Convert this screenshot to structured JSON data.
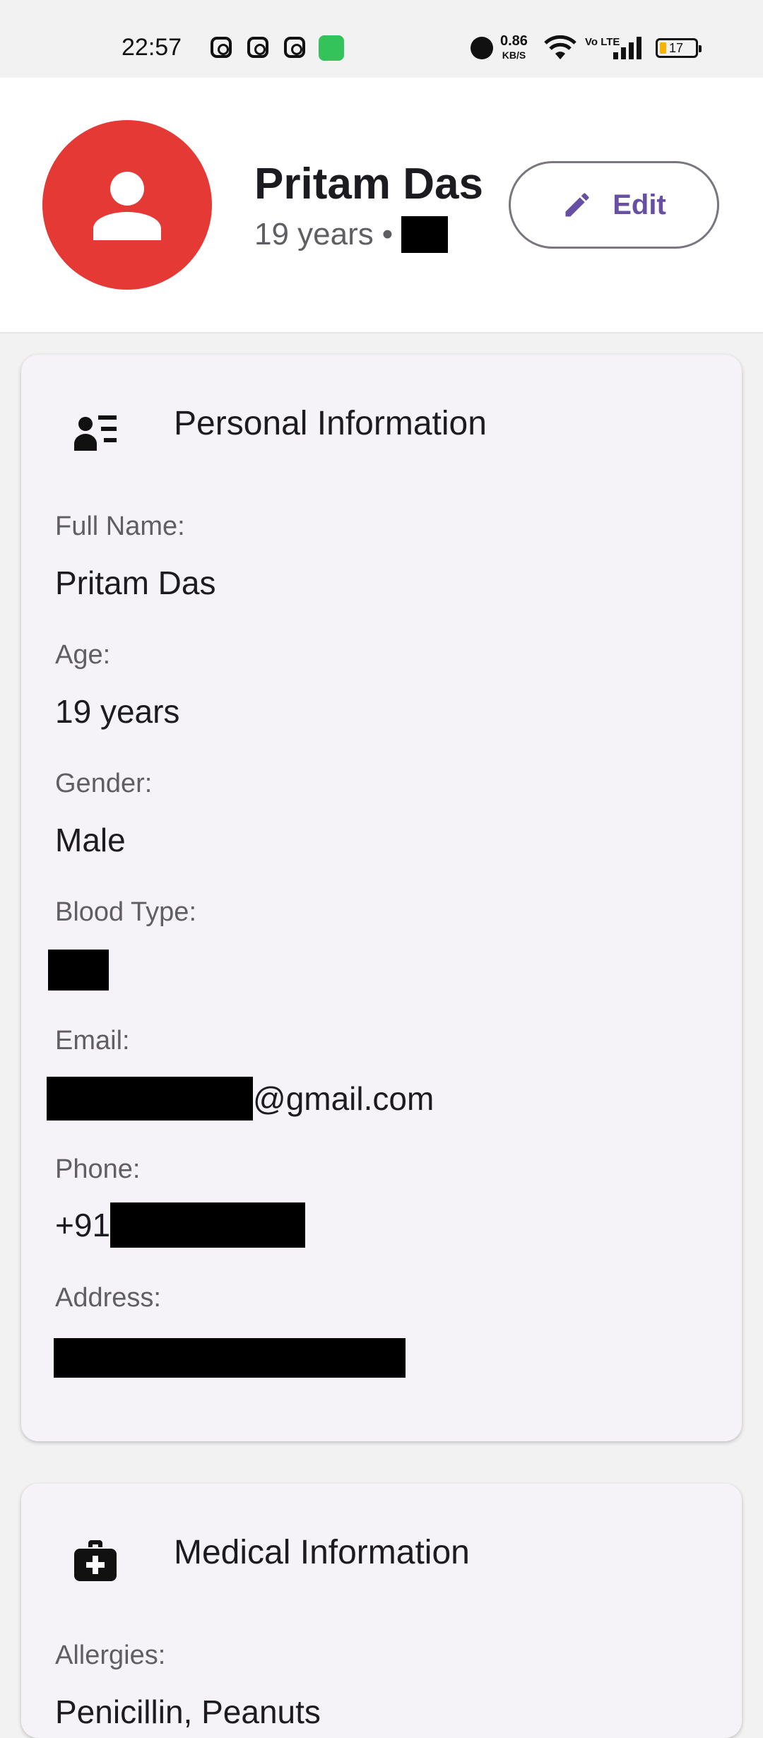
{
  "status_bar": {
    "time": "22:57",
    "notification_icons": [
      "instagram-icon",
      "instagram-icon",
      "instagram-icon",
      "green-app-icon"
    ],
    "net_speed_value": "0.86",
    "net_speed_unit": "KB/S",
    "volte": "Vo LTE",
    "battery_level": "17",
    "battery_color": "#f4b400"
  },
  "profile": {
    "name": "Pritam Das",
    "age_text": "19 years",
    "separator": "•",
    "avatar_color": "#e53935",
    "edit_label": "Edit"
  },
  "personal_info": {
    "title": "Personal Information",
    "fields": [
      {
        "label": "Full Name:",
        "value": "Pritam Das"
      },
      {
        "label": "Age:",
        "value": "19 years"
      },
      {
        "label": "Gender:",
        "value": "Male"
      },
      {
        "label": "Blood Type:",
        "value": ""
      },
      {
        "label": "Email:",
        "value": "@gmail.com"
      },
      {
        "label": "Phone:",
        "value": "+91"
      },
      {
        "label": "Address:",
        "value": ""
      }
    ]
  },
  "medical_info": {
    "title": "Medical Information",
    "fields": [
      {
        "label": "Allergies:",
        "value": "Penicillin, Peanuts"
      }
    ]
  },
  "colors": {
    "accent": "#6750a4",
    "card_background": "#f5f2f8"
  }
}
